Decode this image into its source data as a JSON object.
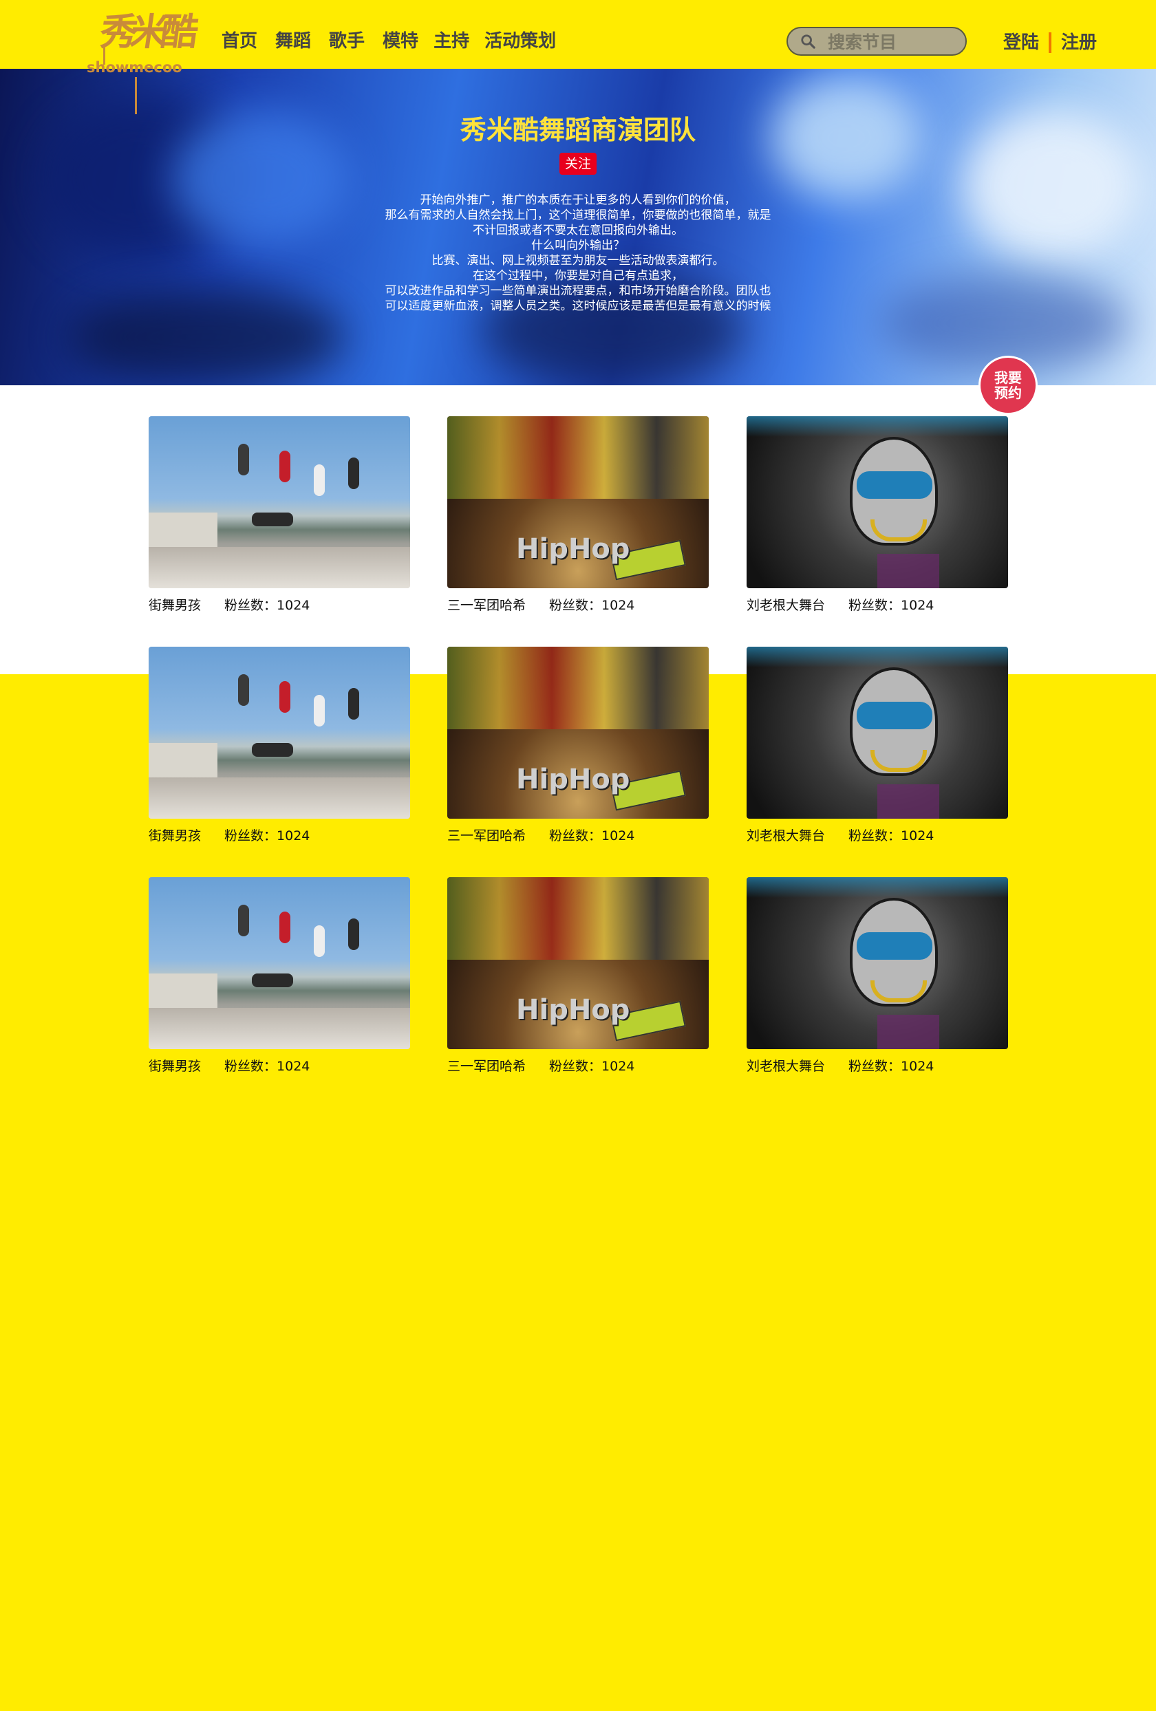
{
  "header": {
    "logo_text": "秀米酷",
    "logo_sub": "showmecoo",
    "nav": [
      "首页",
      "舞蹈",
      "歌手",
      "模特",
      "主持",
      "活动策划"
    ],
    "search_placeholder": "搜索节目",
    "login": "登陆",
    "register": "注册"
  },
  "banner": {
    "title": "秀米酷舞蹈商演团队",
    "follow": "关注",
    "description": [
      "开始向外推广，推广的本质在于让更多的人看到你们的价值，",
      "那么有需求的人自然会找上门，这个道理很简单，你要做的也很简单，就是",
      "不计回报或者不要太在意回报向外输出。",
      "什么叫向外输出？",
      "比赛、演出、网上视频甚至为朋友一些活动做表演都行。",
      "在这个过程中，你要是对自己有点追求，",
      "可以改进作品和学习一些简单演出流程要点，和市场开始磨合阶段。团队也",
      "可以适度更新血液，调整人员之类。这时候应该是最苦但是最有意义的时候"
    ]
  },
  "booking": [
    "我要",
    "预约"
  ],
  "cards": [
    {
      "name": "街舞男孩",
      "fans": "粉丝数：1024",
      "image": "breakdance-group-photo"
    },
    {
      "name": "三一军团哈希",
      "fans": "粉丝数：1024",
      "image": "hiphop-graffiti-photo"
    },
    {
      "name": "刘老根大舞台",
      "fans": "粉丝数：1024",
      "image": "graffiti-mural-photo"
    },
    {
      "name": "街舞男孩",
      "fans": "粉丝数：1024",
      "image": "breakdance-group-photo"
    },
    {
      "name": "三一军团哈希",
      "fans": "粉丝数：1024",
      "image": "hiphop-graffiti-photo"
    },
    {
      "name": "刘老根大舞台",
      "fans": "粉丝数：1024",
      "image": "graffiti-mural-photo"
    },
    {
      "name": "街舞男孩",
      "fans": "粉丝数：1024",
      "image": "breakdance-group-photo"
    },
    {
      "name": "三一军团哈希",
      "fans": "粉丝数：1024",
      "image": "hiphop-graffiti-photo"
    },
    {
      "name": "刘老根大舞台",
      "fans": "粉丝数：1024",
      "image": "graffiti-mural-photo"
    }
  ],
  "colors": {
    "page_bg": "#ffec00",
    "title": "#ffe23b",
    "follow_bg": "#e8001d",
    "booking_bg": "#e0364f",
    "auth_separator": "#f07800"
  }
}
